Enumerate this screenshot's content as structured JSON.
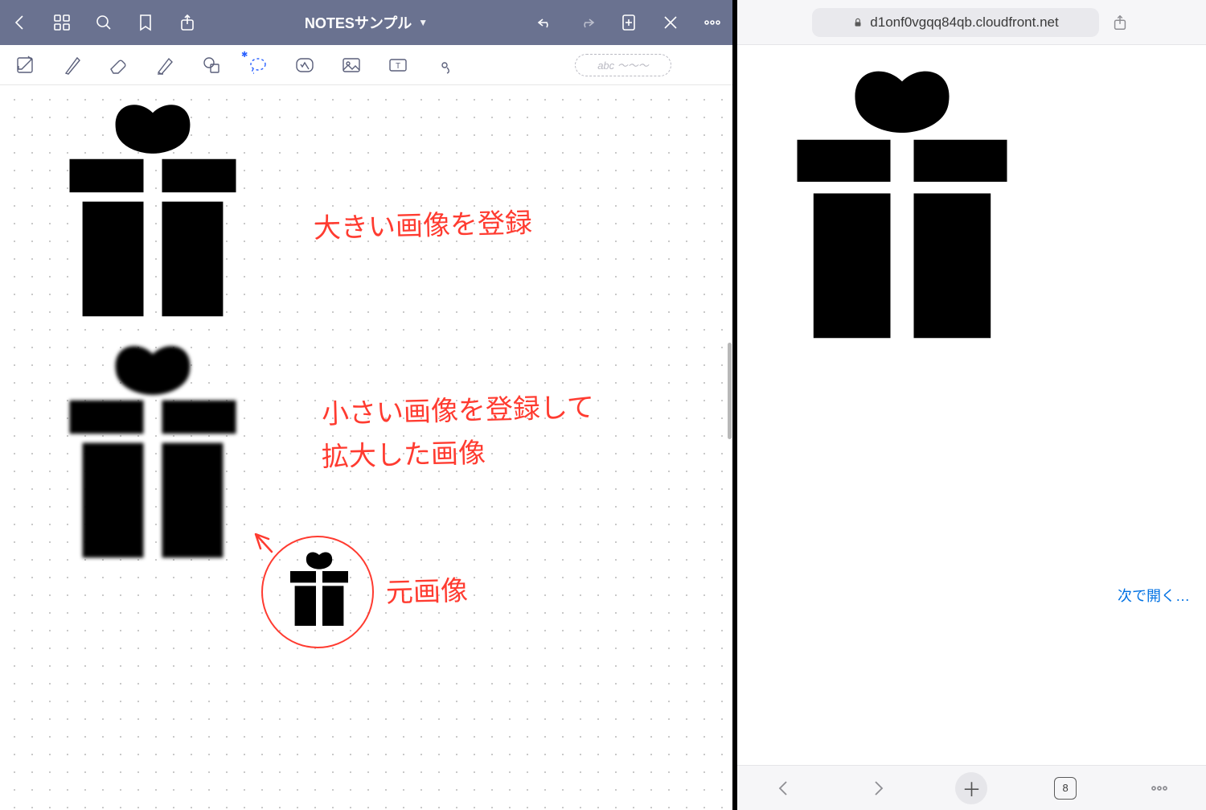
{
  "app": {
    "title": "NOTESサンプル"
  },
  "topbar": {
    "back": "back",
    "thumbnails": "thumbnails",
    "search": "search",
    "bookmark": "bookmark",
    "share": "share",
    "undo": "undo",
    "redo": "redo",
    "add_page": "add-page",
    "close_tool": "close-tool",
    "more": "more"
  },
  "toolbar": {
    "readonly": "readonly-mode",
    "pen": "pen",
    "eraser": "eraser",
    "highlighter": "highlighter",
    "shape": "shape",
    "lasso": "lasso",
    "favorites": "favorites",
    "image": "image",
    "textbox": "textbox",
    "pointer": "pointer",
    "scribble_placeholder": "abc ～～～"
  },
  "annotations": {
    "note1": "大きい画像を登録",
    "note2_line1": "小さい画像を登録して",
    "note2_line2": "拡大した画像",
    "note3": "元画像"
  },
  "browser": {
    "host": "d1onf0vgqq84qb.cloudfront.net",
    "open_next": "次で開く…",
    "tab_count": "8"
  },
  "icons": {
    "gift": "gift-icon"
  },
  "colors": {
    "brand_bar": "#6a7290",
    "ink": "#ff3b30",
    "link": "#0071e3"
  }
}
